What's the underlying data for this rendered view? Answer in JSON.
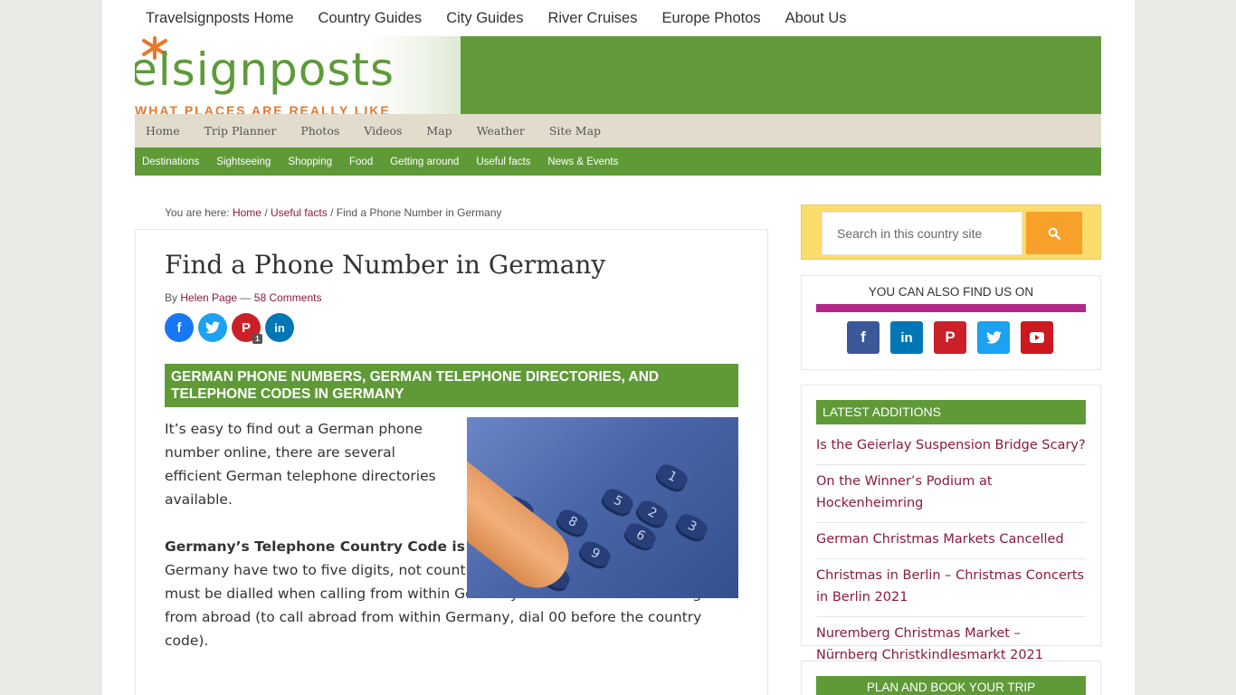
{
  "top_nav": [
    "Travelsignposts Home",
    "Country Guides",
    "City Guides",
    "River Cruises",
    "Europe Photos",
    "About Us"
  ],
  "logo": {
    "text": "elsignposts",
    "tagline": "WHAT PLACES ARE REALLY LIKE"
  },
  "secondary_nav": [
    "Home",
    "Trip Planner",
    "Photos",
    "Videos",
    "Map",
    "Weather",
    "Site Map"
  ],
  "category_nav": [
    "Destinations",
    "Sightseeing",
    "Shopping",
    "Food",
    "Getting around",
    "Useful facts",
    "News & Events"
  ],
  "breadcrumb": {
    "prefix": "You are here:",
    "home": "Home",
    "sep1": "/",
    "section": "Useful facts",
    "sep2": "/",
    "current": "Find a Phone Number in Germany"
  },
  "article": {
    "title": "Find a Phone Number in Germany",
    "by": "By",
    "author": "Helen Page",
    "dash": "—",
    "comments": "58 Comments",
    "share_counts": {
      "pinterest": "1"
    },
    "section_heading": "German phone numbers, German telephone directories, and telephone codes in Germany",
    "para1": "It’s easy to find out a German phone number online, there are several efficient German telephone directories available.",
    "para2_bold": "Germany’s Telephone Country Code is 49",
    "para2_rest": ", and telephone area codes in Germany have two to five digits, not counting the leading zero. The leading zero must be dialled when calling from within Germany and omitted when calling from abroad (to call abroad from within Germany, dial 00 before the country code)."
  },
  "sidebar": {
    "search_placeholder": "Search in this country site",
    "find_us_title": "You can also find us on",
    "latest_title": "Latest Additions",
    "latest": [
      "Is the Geierlay Suspension Bridge Scary?",
      "On the Winner’s Podium at Hockenheimring",
      "German Christmas Markets Cancelled",
      "Christmas in Berlin – Christmas Concerts in Berlin 2021",
      "Nuremberg Christmas Market – Nürnberg Christkindlesmarkt 2021"
    ],
    "plan_title": "Plan and Book Your Trip"
  },
  "colors": {
    "green": "#5f9a37",
    "link": "#8a1a3e",
    "search_bg": "#fbdc6c",
    "search_button": "#f7a12b",
    "accent_bar": "#b3278a"
  },
  "icons": [
    "facebook-icon",
    "twitter-icon",
    "pinterest-icon",
    "linkedin-icon",
    "youtube-icon",
    "search-icon"
  ]
}
